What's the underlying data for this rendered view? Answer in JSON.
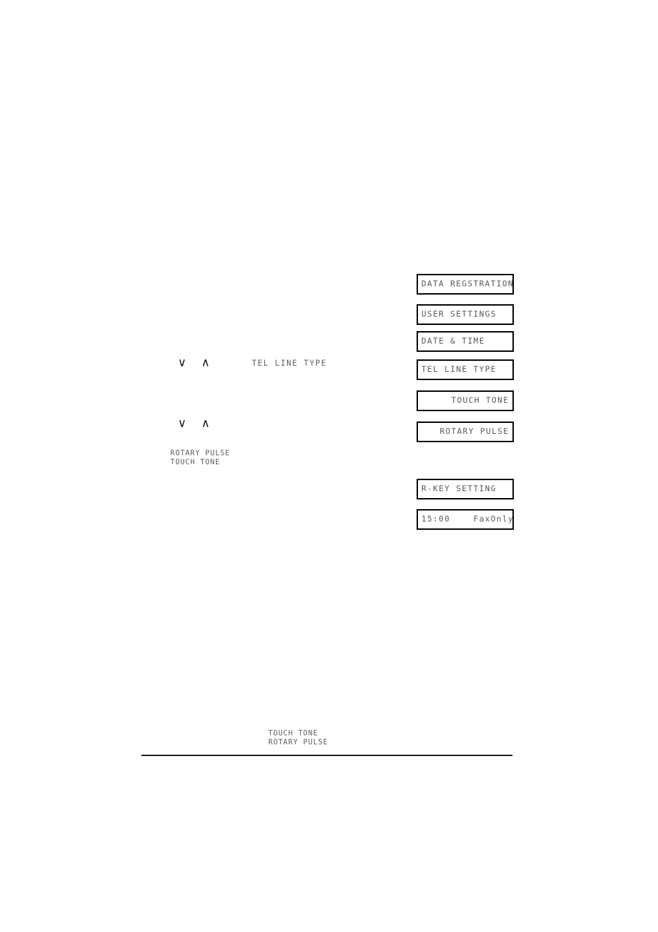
{
  "lcd_sequence": [
    {
      "text": "DATA REGSTRATION",
      "align": "left",
      "name": "lcd-data-registration"
    },
    {
      "text": "USER SETTINGS",
      "align": "left",
      "name": "lcd-user-settings"
    },
    {
      "text": "DATE & TIME",
      "align": "left",
      "name": "lcd-date-and-time"
    },
    {
      "text": "TEL LINE TYPE",
      "align": "left",
      "name": "lcd-tel-line-type"
    },
    {
      "text": "TOUCH TONE",
      "align": "right",
      "name": "lcd-touch-tone"
    },
    {
      "text": "ROTARY PULSE",
      "align": "right",
      "name": "lcd-rotary-pulse"
    },
    {
      "text": "R-KEY SETTING",
      "align": "left",
      "name": "lcd-r-key-setting"
    },
    {
      "text": "15:00    FaxOnly",
      "align": "left",
      "name": "lcd-standby-status"
    }
  ],
  "standby": {
    "time": "15:00",
    "mode": "FaxOnly"
  },
  "steps": {
    "step_one": {
      "down_arrow": "∨",
      "up_arrow": "∧",
      "label": "TEL LINE TYPE"
    },
    "step_two": {
      "down_arrow": "∨",
      "up_arrow": "∧"
    }
  },
  "option_list": "ROTARY PULSE\nTOUCH TONE",
  "footnote_list": "TOUCH TONE\nROTARY PULSE",
  "colors": {
    "lcd_text": "#595959",
    "border": "#000000",
    "body_text": "#5f5f5f",
    "arrow": "#1a1a1a",
    "rule": "#1a1a1a"
  }
}
